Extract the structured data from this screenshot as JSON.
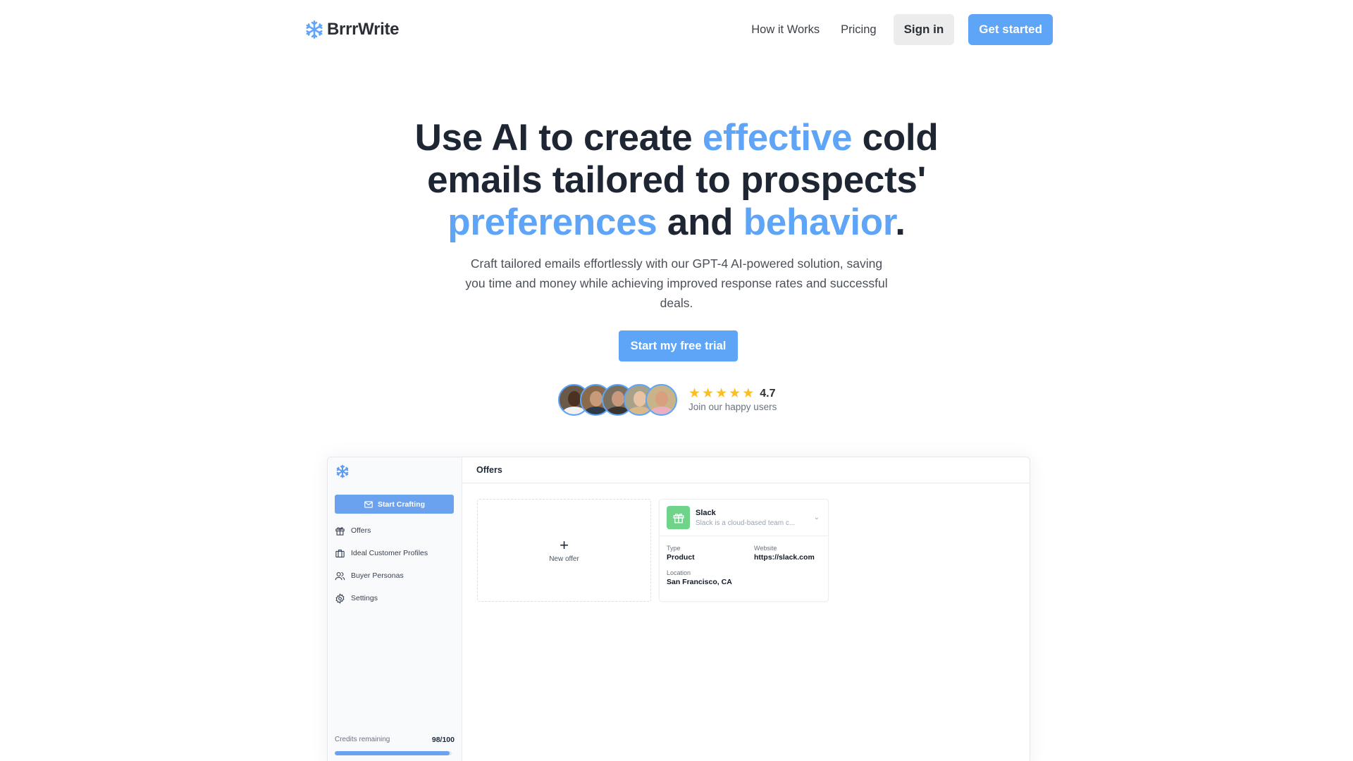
{
  "nav": {
    "brand": "BrrrWrite",
    "brand_icon": "snowflake-icon",
    "links": [
      "How it Works",
      "Pricing"
    ],
    "signin_label": "Sign in",
    "getstarted_label": "Get started",
    "accent_color": "#5ea5f8"
  },
  "hero": {
    "title_parts": {
      "p1": "Use AI to create ",
      "effective": "effective",
      "p2": " cold emails tailored to prospects' ",
      "preferences": "preferences",
      "p3": " and ",
      "behavior": "behavior",
      "p4": "."
    },
    "subtitle": "Craft tailored emails effortlessly with our GPT-4 AI-powered solution, saving you time and money while achieving improved response rates and successful deals.",
    "cta_label": "Start my free trial"
  },
  "social_proof": {
    "avatar_count": 5,
    "stars": 5,
    "rating": "4.7",
    "caption": "Join our happy users"
  },
  "app_preview": {
    "sidebar": {
      "cta_label": "Start Crafting",
      "items": [
        {
          "label": "Offers",
          "icon": "gift-icon"
        },
        {
          "label": "Ideal Customer Profiles",
          "icon": "briefcase-icon"
        },
        {
          "label": "Buyer Personas",
          "icon": "users-icon"
        },
        {
          "label": "Settings",
          "icon": "gear-icon"
        }
      ],
      "credits_label": "Credits remaining",
      "credits_value": "98/100",
      "credits_fraction": 0.98
    },
    "main": {
      "header": "Offers",
      "new_offer_label": "New offer",
      "offer": {
        "name": "Slack",
        "description": "Slack is a cloud-based team c...",
        "type_label": "Type",
        "type_value": "Product",
        "website_label": "Website",
        "website_value": "https://slack.com",
        "location_label": "Location",
        "location_value": "San Francisco, CA"
      }
    }
  }
}
